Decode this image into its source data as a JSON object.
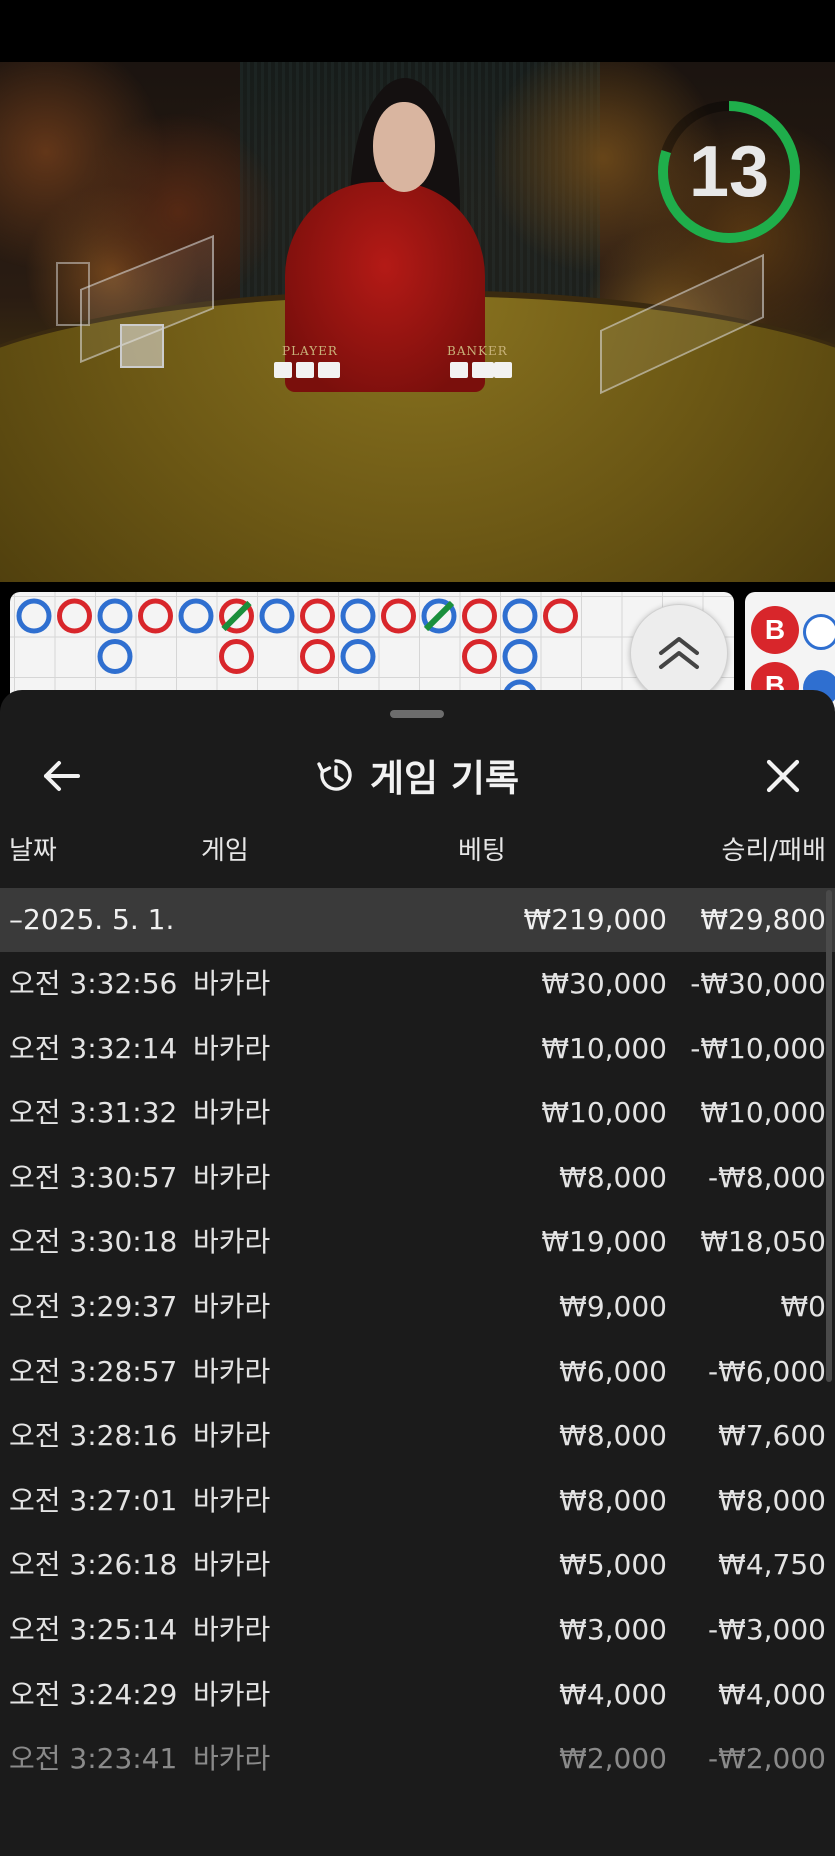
{
  "timer": {
    "value": "13",
    "progress": 0.8,
    "color": "#1fae4b"
  },
  "video": {
    "table_labels": [
      "PLAYER",
      "BANKER"
    ]
  },
  "roadmap": {
    "colors": {
      "player": "#2f6fd0",
      "banker": "#d8262b",
      "tie": "#1a8f3c"
    },
    "side_badges": [
      "B",
      "B"
    ]
  },
  "sheet": {
    "title": "게임 기록",
    "icons": {
      "back": "arrow-left-icon",
      "history": "history-icon",
      "close": "close-icon",
      "scroll_up": "double-chevron-up-icon"
    },
    "columns": {
      "date": "날짜",
      "game": "게임",
      "bet": "베팅",
      "win_loss": "승리/패배"
    },
    "date_summary": {
      "date": "–2025. 5. 1.",
      "bet": "₩219,000",
      "win_loss": "₩29,800"
    },
    "rows": [
      {
        "time": "오전 3:32:56",
        "game": "바카라",
        "bet": "₩30,000",
        "win_loss": "-₩30,000"
      },
      {
        "time": "오전 3:32:14",
        "game": "바카라",
        "bet": "₩10,000",
        "win_loss": "-₩10,000"
      },
      {
        "time": "오전 3:31:32",
        "game": "바카라",
        "bet": "₩10,000",
        "win_loss": "₩10,000"
      },
      {
        "time": "오전 3:30:57",
        "game": "바카라",
        "bet": "₩8,000",
        "win_loss": "-₩8,000"
      },
      {
        "time": "오전 3:30:18",
        "game": "바카라",
        "bet": "₩19,000",
        "win_loss": "₩18,050"
      },
      {
        "time": "오전 3:29:37",
        "game": "바카라",
        "bet": "₩9,000",
        "win_loss": "₩0"
      },
      {
        "time": "오전 3:28:57",
        "game": "바카라",
        "bet": "₩6,000",
        "win_loss": "-₩6,000"
      },
      {
        "time": "오전 3:28:16",
        "game": "바카라",
        "bet": "₩8,000",
        "win_loss": "₩7,600"
      },
      {
        "time": "오전 3:27:01",
        "game": "바카라",
        "bet": "₩8,000",
        "win_loss": "₩8,000"
      },
      {
        "time": "오전 3:26:18",
        "game": "바카라",
        "bet": "₩5,000",
        "win_loss": "₩4,750"
      },
      {
        "time": "오전 3:25:14",
        "game": "바카라",
        "bet": "₩3,000",
        "win_loss": "-₩3,000"
      },
      {
        "time": "오전 3:24:29",
        "game": "바카라",
        "bet": "₩4,000",
        "win_loss": "₩4,000"
      },
      {
        "time": "오전 3:23:41",
        "game": "바카라",
        "bet": "₩2,000",
        "win_loss": "-₩2,000"
      }
    ]
  }
}
